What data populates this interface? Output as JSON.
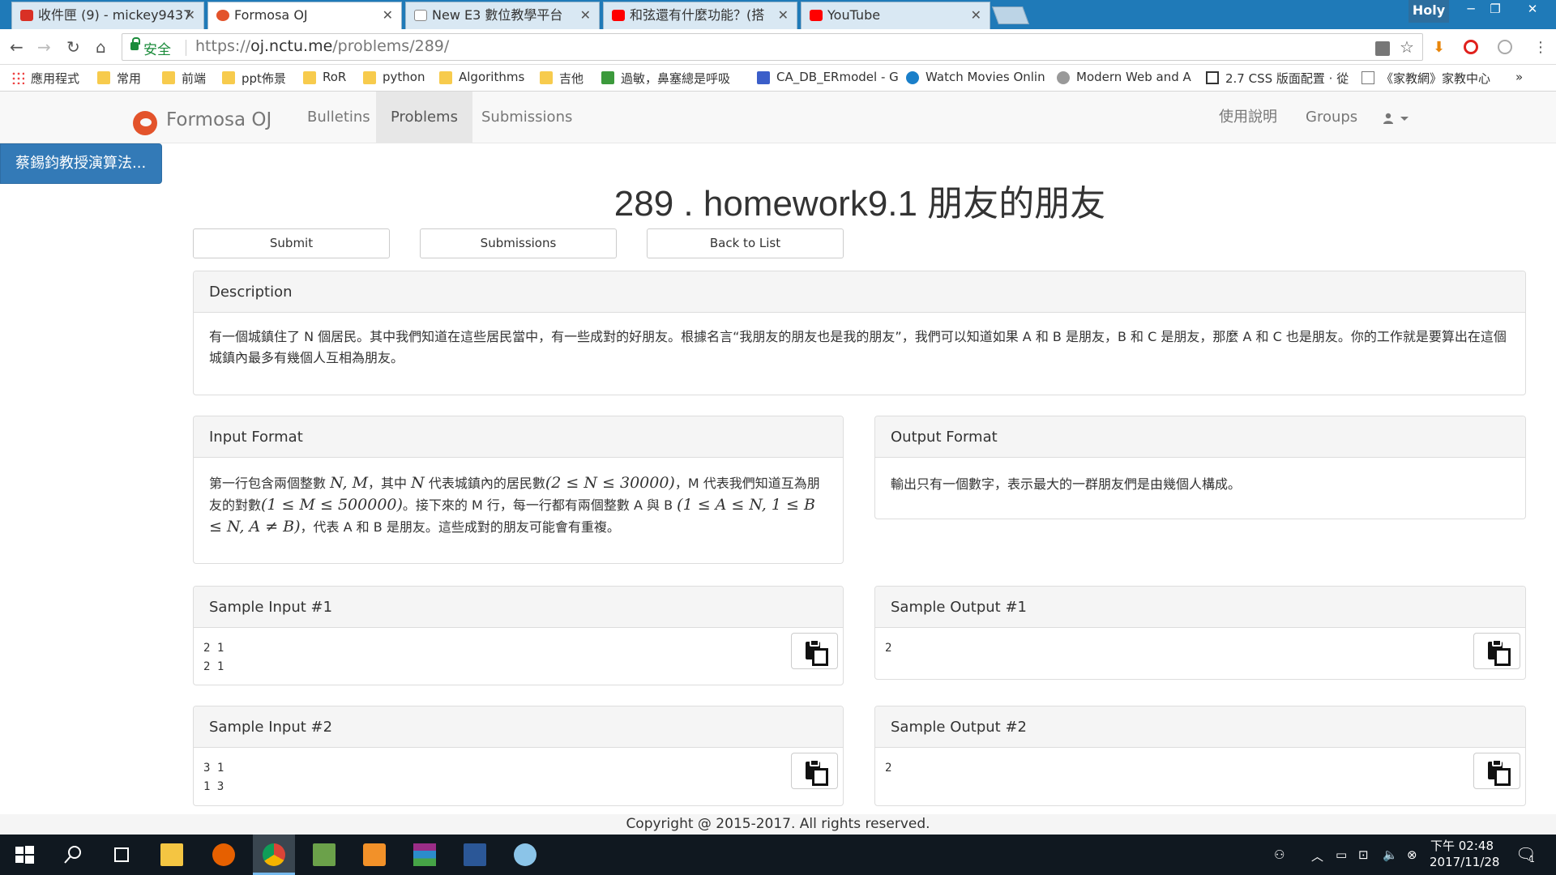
{
  "browser": {
    "tabs": [
      {
        "label": "收件匣 (9) - mickey9437",
        "icon_color": "#d93025",
        "active": false
      },
      {
        "label": "Formosa OJ",
        "icon_color": "#e3532b",
        "active": true
      },
      {
        "label": "New E3 數位教學平台",
        "icon_color": "#888888",
        "active": false
      },
      {
        "label": "和弦還有什麼功能？(搭",
        "icon_color": "#ff0000",
        "active": false
      },
      {
        "label": "YouTube",
        "icon_color": "#ff0000",
        "active": false
      }
    ],
    "profile_name": "Holy",
    "secure_label": "安全",
    "url_base": "https://",
    "url_host": "oj.nctu.me",
    "url_path": "/problems/289/",
    "bookmarks": [
      {
        "label": "應用程式"
      },
      {
        "label": "常用"
      },
      {
        "label": "前端"
      },
      {
        "label": "ppt佈景"
      },
      {
        "label": "RoR"
      },
      {
        "label": "python"
      },
      {
        "label": "Algorithms"
      },
      {
        "label": "吉他"
      },
      {
        "label": "過敏，鼻塞總是呼吸"
      },
      {
        "label": "CA_DB_ERmodel - G"
      },
      {
        "label": "Watch Movies Onlin"
      },
      {
        "label": "Modern Web and A"
      },
      {
        "label": "2.7 CSS 版面配置 · 從"
      },
      {
        "label": "《家教網》家教中心"
      }
    ],
    "more_bookmarks": "»"
  },
  "site": {
    "brand": "Formosa OJ",
    "nav": {
      "bulletins": "Bulletins",
      "problems": "Problems",
      "submissions": "Submissions",
      "help": "使用說明",
      "groups": "Groups"
    },
    "course_button": "蔡錫鈞教授演算法..."
  },
  "problem": {
    "title": "289 . homework9.1 朋友的朋友",
    "actions": {
      "submit": "Submit",
      "submissions": "Submissions",
      "back": "Back to List"
    },
    "description": {
      "heading": "Description",
      "text": "有一個城鎮住了 N 個居民。其中我們知道在這些居民當中，有一些成對的好朋友。根據名言“我朋友的朋友也是我的朋友”，我們可以知道如果 A 和 B 是朋友，B 和 C 是朋友，那麼 A 和 C 也是朋友。你的工作就是要算出在這個城鎮內最多有幾個人互相為朋友。"
    },
    "input_format": {
      "heading": "Input Format",
      "p1": "第一行包含兩個整數 ",
      "m1": "N, M",
      "p2": "，其中 ",
      "m2": "N",
      "p3": " 代表城鎮內的居民數",
      "m3": "(2 ≤ N ≤ 30000)",
      "p4": "，M 代表我們知道互為朋友的對數",
      "m4": "(1 ≤ M ≤ 500000)",
      "p5": "。接下來的 M 行，每一行都有兩個整數 A 與 B ",
      "m5": "(1 ≤ A ≤ N, 1 ≤ B ≤ N, A ≠ B)",
      "p6": "，代表 A 和 B 是朋友。這些成對的朋友可能會有重複。"
    },
    "output_format": {
      "heading": "Output Format",
      "text": "輸出只有一個數字，表示最大的一群朋友們是由幾個人構成。"
    },
    "samples": [
      {
        "in_heading": "Sample Input #1",
        "in_lines": [
          "2 1",
          "2 1"
        ],
        "out_heading": "Sample Output #1",
        "out_lines": [
          "2"
        ]
      },
      {
        "in_heading": "Sample Input #2",
        "in_lines": [
          "3 1",
          "1 3"
        ],
        "out_heading": "Sample Output #2",
        "out_lines": [
          "2"
        ]
      }
    ]
  },
  "footer": "Copyright @ 2015-2017. All rights reserved.",
  "taskbar": {
    "clock_time": "下午 02:48",
    "clock_date": "2017/11/28",
    "notification_count": "1"
  }
}
